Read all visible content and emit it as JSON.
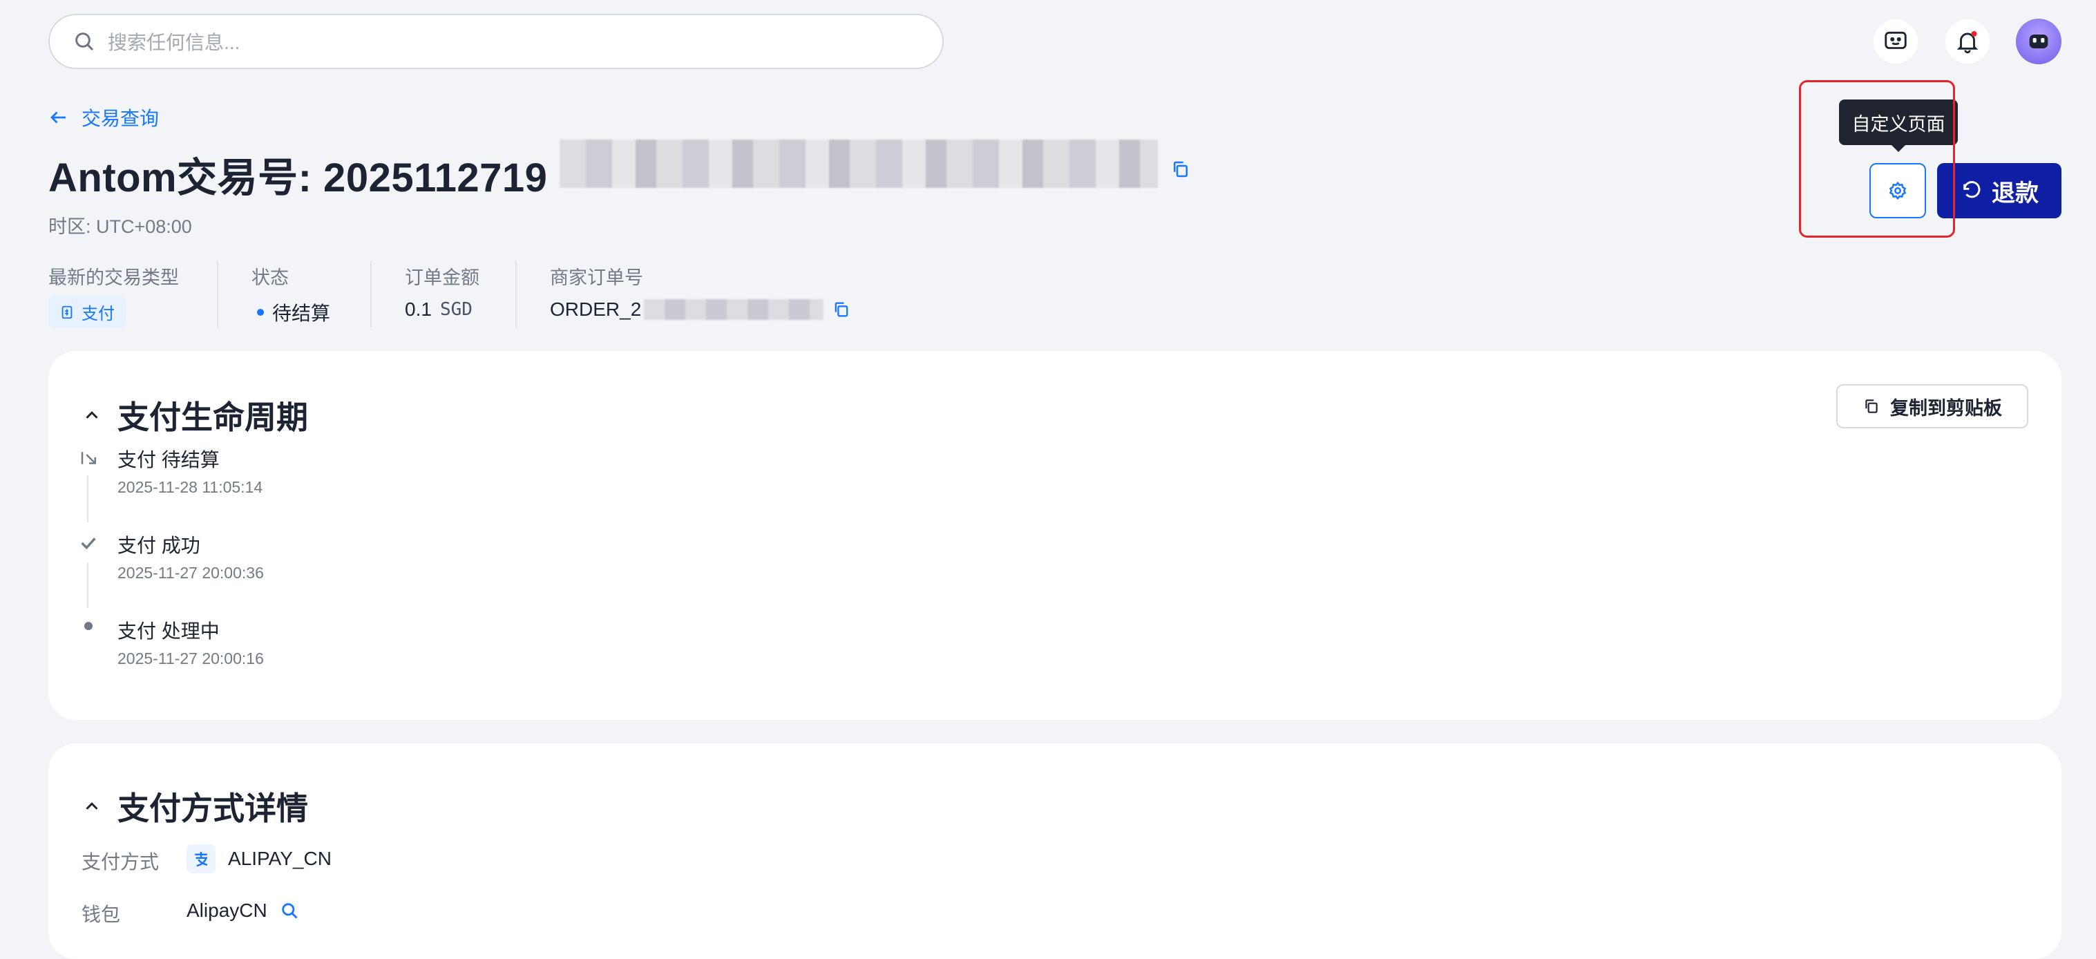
{
  "topbar": {
    "search_placeholder": "搜索任何信息..."
  },
  "header": {
    "breadcrumb": "交易查询",
    "title_prefix": "Antom交易号: 2025112719",
    "timezone": "时区: UTC+08:00"
  },
  "summary": {
    "type": {
      "label": "最新的交易类型",
      "value": "支付"
    },
    "status": {
      "label": "状态",
      "value": "待结算"
    },
    "amount": {
      "label": "订单金额",
      "value": "0.1",
      "currency": "SGD"
    },
    "order": {
      "label": "商家订单号",
      "value": "ORDER_2"
    }
  },
  "actions": {
    "tooltip": "自定义页面",
    "refund_label": "退款"
  },
  "lifecycle": {
    "title": "支付生命周期",
    "copy_label": "复制到剪贴板",
    "events": [
      {
        "title": "支付 待结算",
        "time": "2025-11-28 11:05:14",
        "icon": "pending-arrow-icon"
      },
      {
        "title": "支付 成功",
        "time": "2025-11-27 20:00:36",
        "icon": "check-icon"
      },
      {
        "title": "支付 处理中",
        "time": "2025-11-27 20:00:16",
        "icon": "dot-icon"
      }
    ]
  },
  "payment_method": {
    "title": "支付方式详情",
    "rows": [
      {
        "label": "支付方式",
        "value": "ALIPAY_CN"
      },
      {
        "label": "钱包",
        "value": "AlipayCN"
      }
    ]
  },
  "colors": {
    "accent": "#1677ff",
    "refund": "#0f1fa3",
    "highlight": "#e8242b"
  }
}
